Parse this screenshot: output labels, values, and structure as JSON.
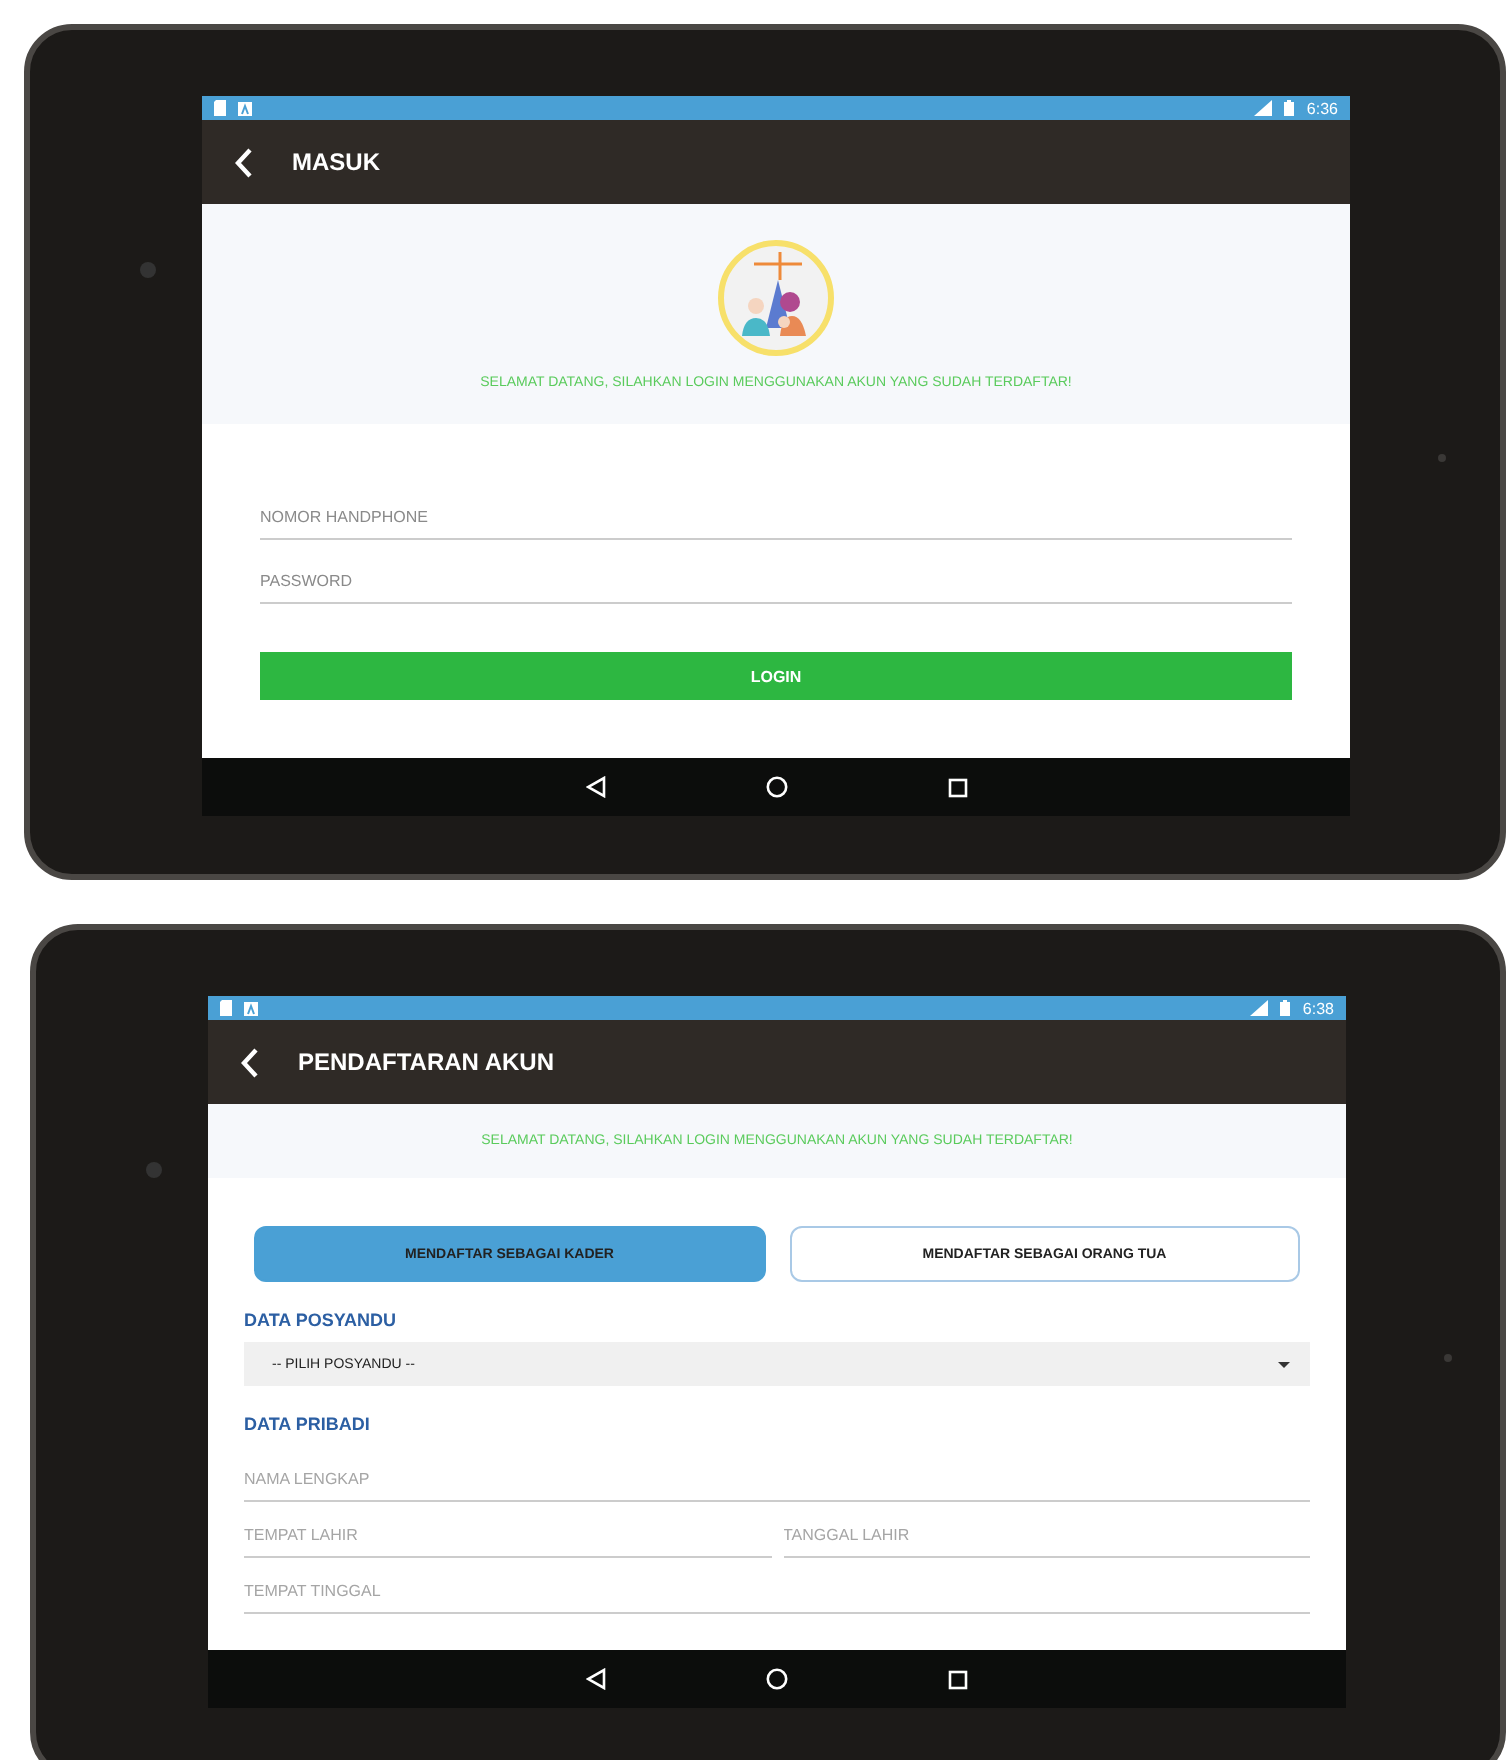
{
  "screens": [
    {
      "status_bar": {
        "time": "6:36"
      },
      "app_bar": {
        "title": "MASUK"
      },
      "header": {
        "logo": true,
        "welcome": "SELAMAT DATANG, SILAHKAN LOGIN MENGGUNAKAN AKUN YANG SUDAH TERDAFTAR!"
      },
      "fields": [
        {
          "placeholder": "NOMOR HANDPHONE"
        },
        {
          "placeholder": "PASSWORD"
        }
      ],
      "button": "LOGIN"
    },
    {
      "status_bar": {
        "time": "6:38"
      },
      "app_bar": {
        "title": "PENDAFTARAN AKUN"
      },
      "header": {
        "welcome": "SELAMAT DATANG, SILAHKAN LOGIN MENGGUNAKAN AKUN YANG SUDAH TERDAFTAR!"
      },
      "role_tabs": [
        {
          "label": "MENDAFTAR SEBAGAI KADER",
          "selected": true
        },
        {
          "label": "MENDAFTAR SEBAGAI ORANG TUA",
          "selected": false
        }
      ],
      "sections": [
        {
          "title": "DATA POSYANDU",
          "rows": [
            [
              {
                "kind": "dropdown",
                "value": "-- PILIH POSYANDU --"
              }
            ]
          ]
        },
        {
          "title": "DATA PRIBADI",
          "rows": [
            [
              {
                "kind": "text",
                "placeholder": "NAMA LENGKAP"
              }
            ],
            [
              {
                "kind": "text",
                "placeholder": "TEMPAT LAHIR"
              },
              {
                "kind": "text",
                "placeholder": "TANGGAL LAHIR"
              }
            ],
            [
              {
                "kind": "text",
                "placeholder": "TEMPAT TINGGAL"
              }
            ]
          ]
        }
      ]
    }
  ]
}
